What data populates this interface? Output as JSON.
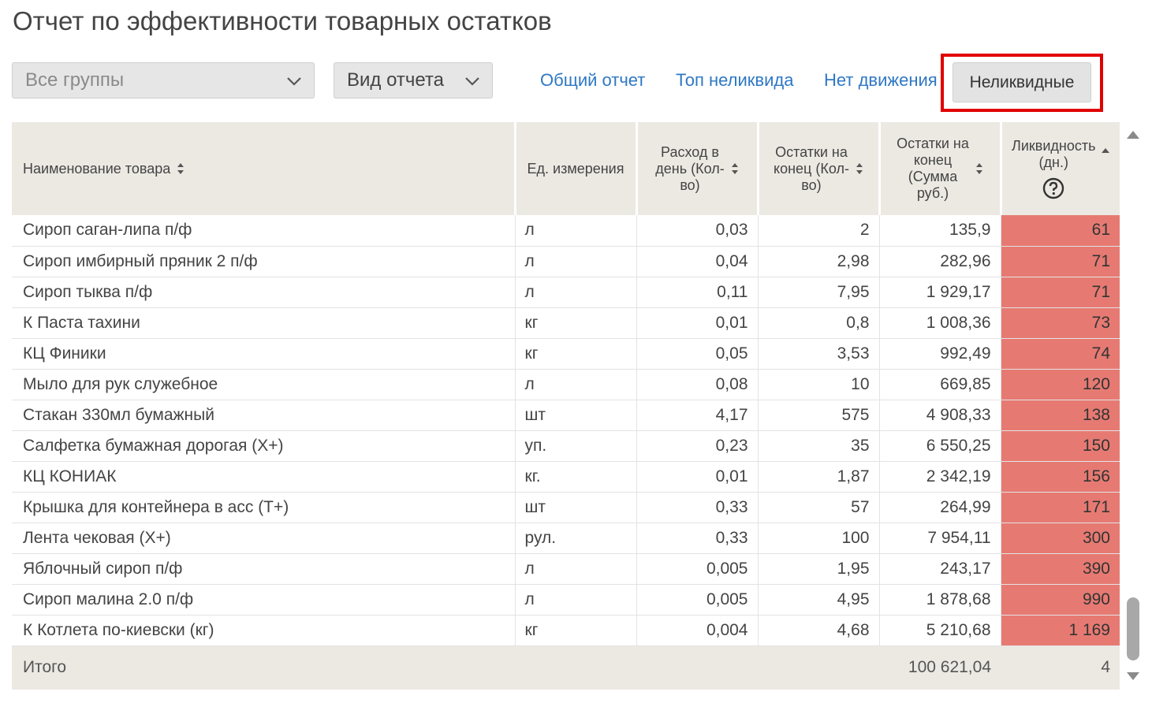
{
  "page_title": "Отчет по эффективности товарных остатков",
  "filters": {
    "groups": "Все группы",
    "view": "Вид отчета"
  },
  "links": {
    "general": "Общий отчет",
    "top_illiquid": "Топ неликвида",
    "no_movement": "Нет движения",
    "illiquid": "Неликвидные"
  },
  "columns": {
    "name": "Наименование товара",
    "unit": "Ед. измерения",
    "daily_l1": "Расход в",
    "daily_l2": "день (Кол-",
    "daily_l3": "во)",
    "stock_qty_l1": "Остатки на",
    "stock_qty_l2": "конец (Кол-",
    "stock_qty_l3": "во)",
    "stock_sum_l1": "Остатки на",
    "stock_sum_l2": "конец",
    "stock_sum_l3": "(Сумма",
    "stock_sum_l4": "руб.)",
    "liquidity_l1": "Ликвидность",
    "liquidity_l2": "(дн.)"
  },
  "rows": [
    {
      "name": "Сироп саган-липа п/ф",
      "unit": "л",
      "daily": "0,03",
      "qty": "2",
      "sum": "135,9",
      "liq": "61"
    },
    {
      "name": "Сироп имбирный пряник 2 п/ф",
      "unit": "л",
      "daily": "0,04",
      "qty": "2,98",
      "sum": "282,96",
      "liq": "71"
    },
    {
      "name": "Сироп тыква п/ф",
      "unit": "л",
      "daily": "0,11",
      "qty": "7,95",
      "sum": "1 929,17",
      "liq": "71"
    },
    {
      "name": "К Паста тахини",
      "unit": "кг",
      "daily": "0,01",
      "qty": "0,8",
      "sum": "1 008,36",
      "liq": "73"
    },
    {
      "name": "КЦ Финики",
      "unit": "кг",
      "daily": "0,05",
      "qty": "3,53",
      "sum": "992,49",
      "liq": "74"
    },
    {
      "name": "Мыло для рук служебное",
      "unit": "л",
      "daily": "0,08",
      "qty": "10",
      "sum": "669,85",
      "liq": "120"
    },
    {
      "name": "Стакан 330мл бумажный",
      "unit": "шт",
      "daily": "4,17",
      "qty": "575",
      "sum": "4 908,33",
      "liq": "138"
    },
    {
      "name": "Салфетка бумажная дорогая (Х+)",
      "unit": "уп.",
      "daily": "0,23",
      "qty": "35",
      "sum": "6 550,25",
      "liq": "150"
    },
    {
      "name": "КЦ КОНИАК",
      "unit": "кг.",
      "daily": "0,01",
      "qty": "1,87",
      "sum": "2 342,19",
      "liq": "156"
    },
    {
      "name": "Крышка для контейнера в асс (Т+)",
      "unit": "шт",
      "daily": "0,33",
      "qty": "57",
      "sum": "264,99",
      "liq": "171"
    },
    {
      "name": "Лента чековая (Х+)",
      "unit": "рул.",
      "daily": "0,33",
      "qty": "100",
      "sum": "7 954,11",
      "liq": "300"
    },
    {
      "name": "Яблочный сироп п/ф",
      "unit": "л",
      "daily": "0,005",
      "qty": "1,95",
      "sum": "243,17",
      "liq": "390"
    },
    {
      "name": "Сироп малина 2.0 п/ф",
      "unit": "л",
      "daily": "0,005",
      "qty": "4,95",
      "sum": "1 878,68",
      "liq": "990"
    },
    {
      "name": "К Котлета по-киевски (кг)",
      "unit": "кг",
      "daily": "0,004",
      "qty": "4,68",
      "sum": "5 210,68",
      "liq": "1 169"
    }
  ],
  "total": {
    "label": "Итого",
    "sum": "100 621,04",
    "liq": "4"
  },
  "colors": {
    "highlight_border": "#e10000",
    "liquidity_cell": "#e67a72",
    "link": "#2f78c4",
    "header_bg": "#ece9e3"
  }
}
